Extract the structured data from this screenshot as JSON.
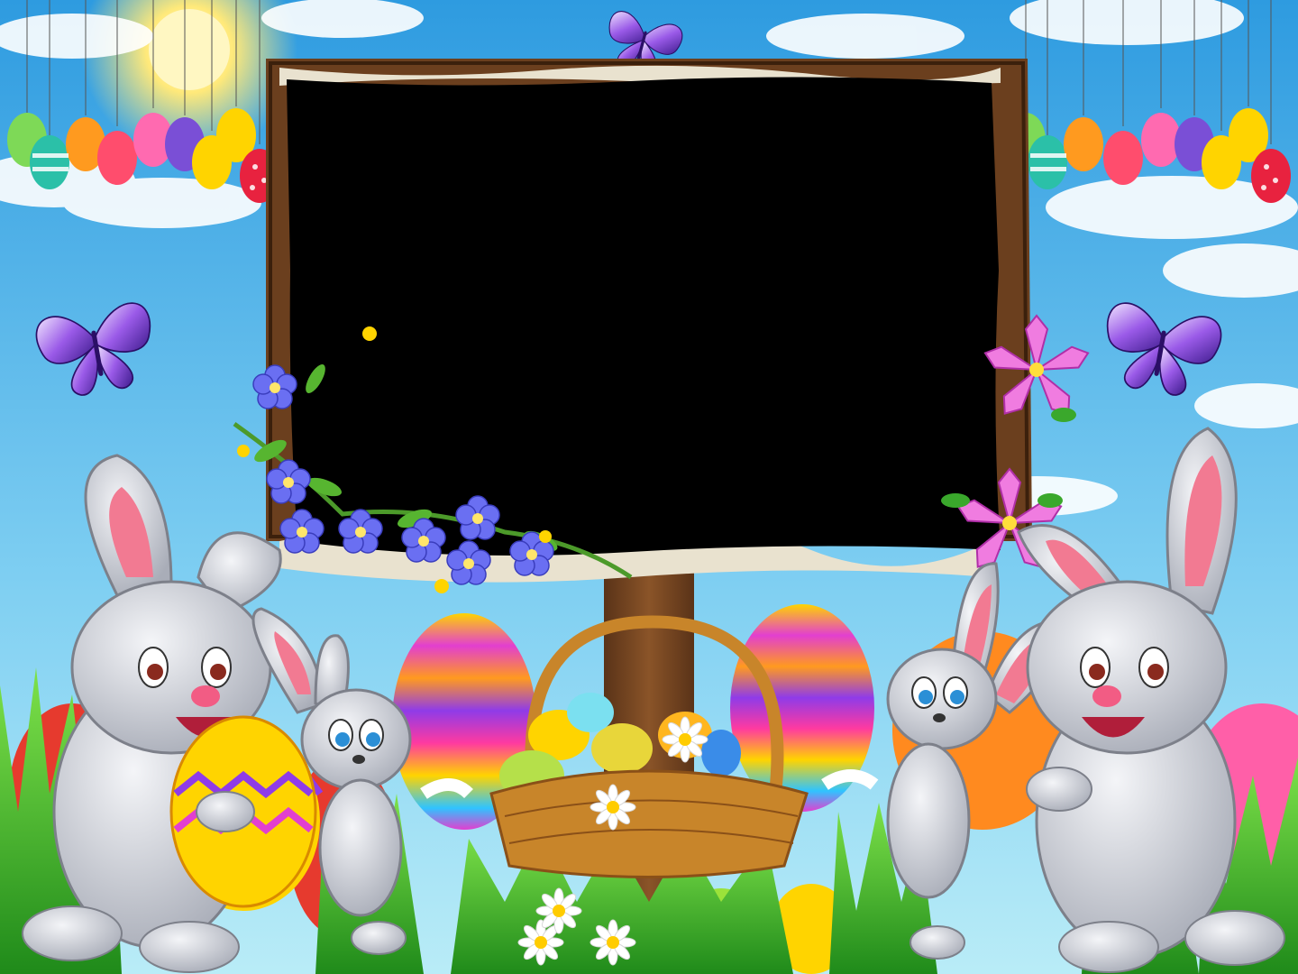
{
  "scene": {
    "kind": "easter-photo-frame",
    "colors": {
      "sky_top": "#2e9be0",
      "sky_bottom": "#9fe0f5",
      "photo_window": "#000000",
      "board_wood": "#6b3f1e",
      "grass": "#3fb52c",
      "bunny_fur": "#c9ccd3",
      "ear_inner": "#f27a92",
      "butterfly": "#7b3fd6"
    },
    "elements": [
      "sun",
      "clouds",
      "hanging-eggs-left",
      "hanging-eggs-right",
      "wooden-signboard",
      "photo-window",
      "butterfly-top",
      "butterfly-left",
      "butterfly-right",
      "flower-garland",
      "pink-flowers",
      "bunny-large-left",
      "bunny-small-left",
      "bunny-small-right",
      "bunny-large-right",
      "egg-basket",
      "painted-eggs",
      "grass",
      "daisies"
    ]
  }
}
